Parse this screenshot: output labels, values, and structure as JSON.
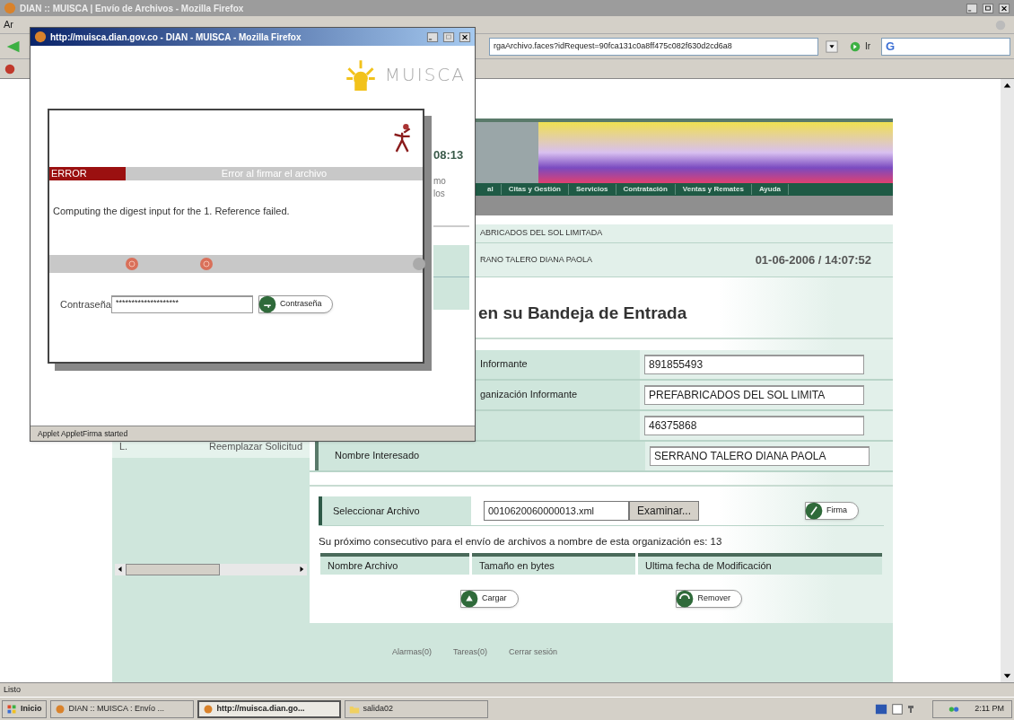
{
  "browser": {
    "title": "DIAN :: MUISCA | Envío de Archivos - Mozilla Firefox",
    "menu_fragment": "Ar",
    "address": "rgaArchivo.faces?idRequest=90fca131c0a8ff475c082f630d2cd6a8",
    "go_label": "Ir",
    "search_text": "G",
    "status": "Listo"
  },
  "page": {
    "clock_fragment": "08:13",
    "intro_fragments": [
      "mo",
      "los"
    ],
    "nav": [
      "al",
      "Citas y Gestión",
      "Servicios",
      "Contratación",
      "Ventas y Remates",
      "Ayuda"
    ],
    "organization": "ABRICADOS DEL SOL LIMITADA",
    "user": "RANO TALERO DIANA PAOLA",
    "datetime": "01-06-2006 / 14:07:52",
    "heading": "en su Bandeja de Entrada",
    "side_menu": [
      {
        "marker": "L.",
        "label": "Reemplazar Solicitud"
      }
    ],
    "fields": [
      {
        "label": "Informante",
        "value": "891855493",
        "cut": true
      },
      {
        "label": "ganización Informante",
        "value": "PREFABRICADOS DEL SOL LIMITA",
        "cut": true
      },
      {
        "value": "46375868",
        "cut": true
      },
      {
        "label": "Nombre Interesado",
        "value": "SERRANO TALERO DIANA PAOLA",
        "cut": false
      }
    ],
    "file": {
      "label": "Seleccionar Archivo",
      "value": "0010620060000013.xml",
      "browse": "Examinar...",
      "sign": "Firma"
    },
    "note": "Su próximo consecutivo para el envío de archivos a nombre de esta organización es: 13",
    "table": {
      "columns": [
        "Nombre Archivo",
        "Tamaño en bytes",
        "Ultima fecha de Modificación"
      ]
    },
    "actions": [
      "Cargar",
      "Remover"
    ],
    "footer_links": [
      "Alarmas(0)",
      "Tareas(0)",
      "Cerrar sesión"
    ]
  },
  "popup": {
    "title": "http://muisca.dian.gov.co - DIAN - MUISCA - Mozilla Firefox",
    "logo": "MUISCA",
    "error_tag": "ERROR",
    "error_title": "Error al firmar el archivo",
    "message": "Computing the digest input for the 1. Reference failed.",
    "password_label": "Contraseña",
    "password_value": "********************",
    "password_button": "Contraseña",
    "status": "Applet AppletFirma started"
  },
  "taskbar": {
    "start": "Inicio",
    "tasks": [
      {
        "label": "DIAN :: MUISCA : Envío ...",
        "selected": false
      },
      {
        "label": "http://muisca.dian.go...",
        "selected": true
      },
      {
        "label": "salida02",
        "selected": false
      }
    ],
    "clock": "2:11 PM"
  }
}
